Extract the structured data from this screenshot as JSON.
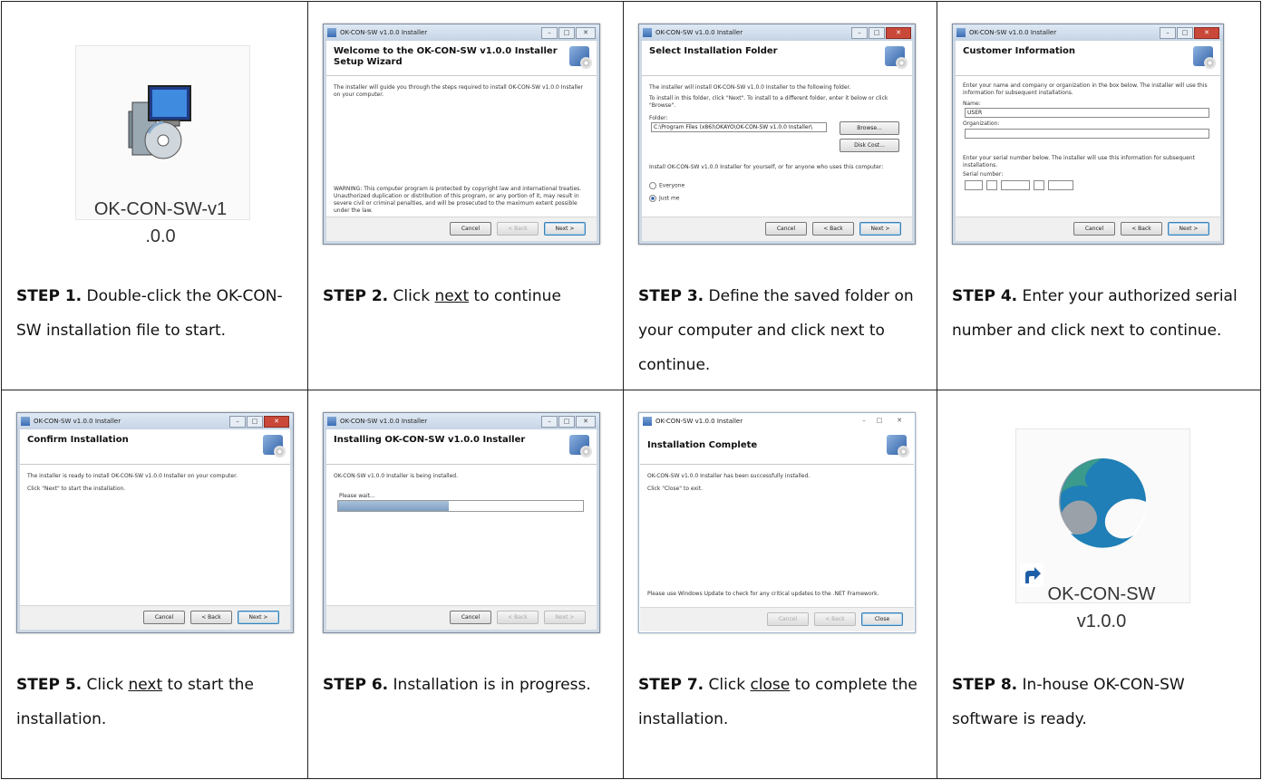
{
  "steps": [
    {
      "label": "STEP 1.",
      "text": " Double-click the OK-CON-SW installation file to start.",
      "icon_label_line1": "OK-CON-SW-v1",
      "icon_label_line2": ".0.0"
    },
    {
      "label": "STEP 2.",
      "pre": " Click ",
      "link": "next",
      "post": " to continue",
      "window_title": "OK-CON-SW v1.0.0 Installer",
      "dialog_title": "Welcome to the OK-CON-SW v1.0.0 Installer Setup Wizard",
      "intro": "The installer will guide you through the steps required to install OK-CON-SW v1.0.0 Installer on your computer.",
      "warning": "WARNING: This computer program is protected by copyright law and international treaties. Unauthorized duplication or distribution of this program, or any portion of it, may result in severe civil or criminal penalties, and will be prosecuted to the maximum extent possible under the law.",
      "buttons": [
        "Cancel",
        "< Back",
        "Next >"
      ]
    },
    {
      "label": "STEP 3.",
      "text": " Define the saved folder on your computer and click next to continue.",
      "window_title": "OK-CON-SW v1.0.0 Installer",
      "dialog_title": "Select Installation Folder",
      "line1": "The installer will install OK-CON-SW v1.0.0 Installer to the following folder.",
      "line2": "To install in this folder, click \"Next\". To install to a different folder, enter it below or click \"Browse\".",
      "folder_label": "Folder:",
      "folder_value": "C:\\Program Files (x86)\\OKAYO\\OK-CON-SW v1.0.0 Installer\\",
      "browse": "Browse...",
      "disk_cost": "Disk Cost...",
      "install_for": "Install OK-CON-SW v1.0.0 Installer for yourself, or for anyone who uses this computer:",
      "everyone": "Everyone",
      "just_me": "Just me",
      "buttons": [
        "Cancel",
        "< Back",
        "Next >"
      ]
    },
    {
      "label": "STEP 4.",
      "text": " Enter your authorized serial number and click next to continue.",
      "window_title": "OK-CON-SW v1.0.0 Installer",
      "dialog_title": "Customer Information",
      "line1": "Enter your name and company or organization in the box below. The installer will use this information for subsequent installations.",
      "name_label": "Name:",
      "name_value": "USER",
      "org_label": "Organization:",
      "line2": "Enter your serial number below. The installer will use this information for subsequent installations.",
      "serial_label": "Serial number:",
      "buttons": [
        "Cancel",
        "< Back",
        "Next >"
      ]
    },
    {
      "label": "STEP 5.",
      "pre": " Click ",
      "link": "next",
      "post": " to start the installation.",
      "window_title": "OK-CON-SW v1.0.0 Installer",
      "dialog_title": "Confirm Installation",
      "line1": "The installer is ready to install OK-CON-SW v1.0.0 Installer on your computer.",
      "line2": "Click \"Next\" to start the installation.",
      "buttons": [
        "Cancel",
        "< Back",
        "Next >"
      ]
    },
    {
      "label": "STEP 6.",
      "text": " Installation is in progress.",
      "window_title": "OK-CON-SW v1.0.0 Installer",
      "dialog_title": "Installing OK-CON-SW v1.0.0 Installer",
      "line1": "OK-CON-SW v1.0.0 Installer is being installed.",
      "wait": "Please wait...",
      "progress": 0.45,
      "buttons": [
        "Cancel",
        "< Back",
        "Next >"
      ]
    },
    {
      "label": "STEP 7.",
      "pre": " Click ",
      "link": "close",
      "post": " to complete the installation.",
      "window_title": "OK-CON-SW v1.0.0 Installer",
      "dialog_title": "Installation Complete",
      "line1": "OK-CON-SW v1.0.0 Installer has been successfully installed.",
      "line2": "Click \"Close\" to exit.",
      "line3": "Please use Windows Update to check for any critical updates to the .NET Framework.",
      "buttons": [
        "Cancel",
        "< Back",
        "Close"
      ]
    },
    {
      "label": "STEP 8.",
      "text": " In-house OK-CON-SW software is ready.",
      "icon_label_line1": "OK-CON-SW",
      "icon_label_line2": "v1.0.0"
    }
  ],
  "colors": {
    "logo_blue": "#1f7fb6",
    "logo_teal": "#3a9a8c",
    "logo_gray": "#9aa1a8"
  }
}
